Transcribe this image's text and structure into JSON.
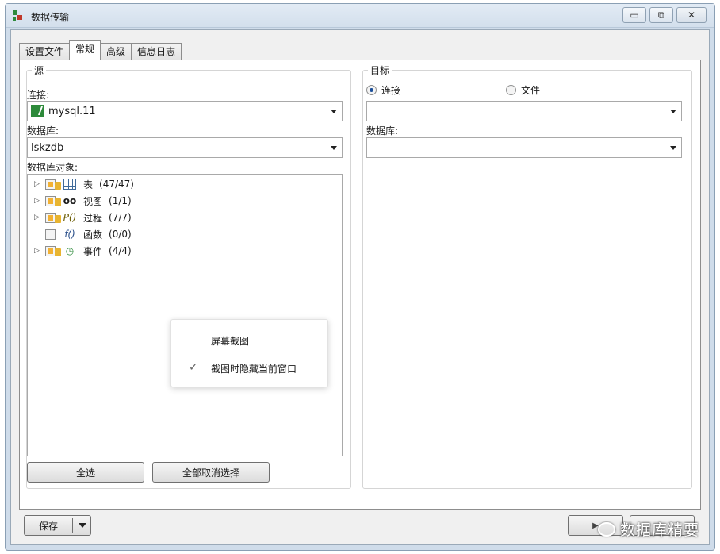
{
  "window": {
    "title": "数据传输",
    "minimize_glyph": "▭",
    "restore_glyph": "⧉",
    "close_glyph": "✕"
  },
  "tabs": [
    {
      "label": "设置文件"
    },
    {
      "label": "常规"
    },
    {
      "label": "高级"
    },
    {
      "label": "信息日志"
    }
  ],
  "source": {
    "group_title": "源",
    "connection_label": "连接:",
    "connection_value": "mysql.11",
    "database_label": "数据库:",
    "database_value": "lskzdb",
    "objects_label": "数据库对象:",
    "tree": [
      {
        "name": "表",
        "count": "(47/47)",
        "icon": "table-icon",
        "expandable": true,
        "partial": true
      },
      {
        "name": "视图",
        "count": "(1/1)",
        "icon": "view-icon",
        "expandable": true,
        "partial": true
      },
      {
        "name": "过程",
        "count": "(7/7)",
        "icon": "procedure-icon",
        "expandable": true,
        "partial": true
      },
      {
        "name": "函数",
        "count": "(0/0)",
        "icon": "function-icon",
        "expandable": false,
        "partial": false
      },
      {
        "name": "事件",
        "count": "(4/4)",
        "icon": "event-icon",
        "expandable": true,
        "partial": true
      }
    ],
    "select_all_label": "全选",
    "deselect_all_label": "全部取消选择"
  },
  "target": {
    "group_title": "目标",
    "radio_connection_label": "连接",
    "radio_file_label": "文件",
    "database_label": "数据库:",
    "connection_value": "",
    "database_value": ""
  },
  "context_menu": {
    "item1": "屏幕截图",
    "item2": "截图时隐藏当前窗口",
    "check_glyph": "✓"
  },
  "footer": {
    "save_label": "保存",
    "start_glyph": "▶"
  },
  "watermark": {
    "text": "数据库精要"
  },
  "colors": {
    "accent": "#1b4f9a",
    "connection_icon": "#2d8a3a",
    "partial_check": "#f2b134"
  }
}
